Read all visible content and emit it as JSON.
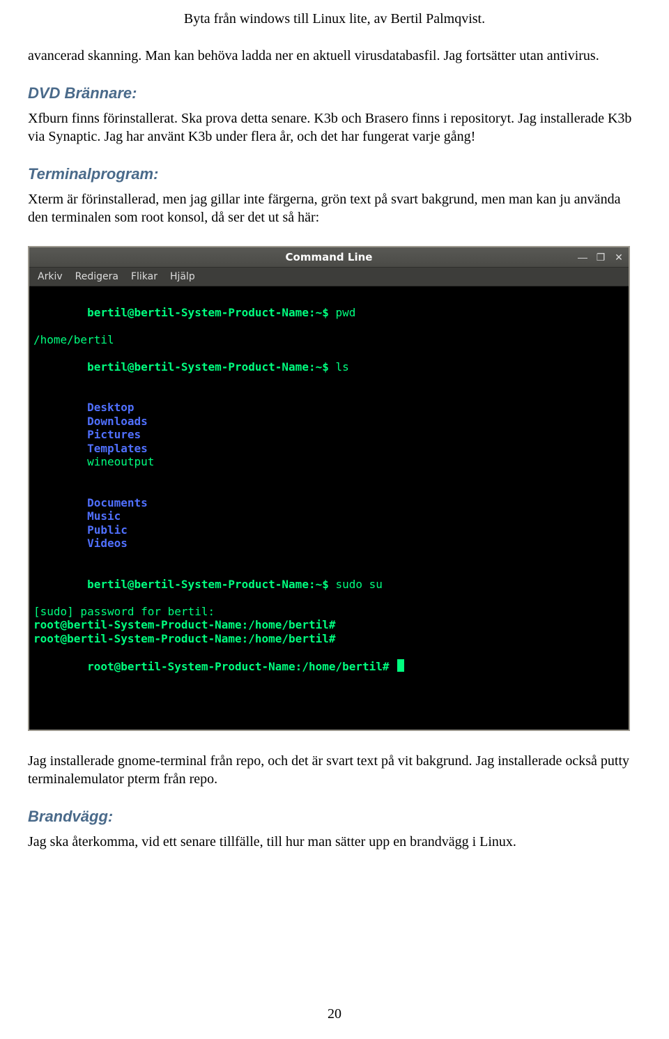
{
  "header": {
    "title": "Byta från windows till Linux lite, av Bertil Palmqvist."
  },
  "intro": {
    "p1": "avancerad skanning. Man kan behöva ladda ner en aktuell virusdatabasfil. Jag fortsätter utan antivirus."
  },
  "sections": {
    "dvd": {
      "heading": "DVD Brännare:",
      "p1": "Xfburn finns förinstallerat. Ska prova detta senare. K3b och Brasero finns i repositoryt. Jag installerade K3b via Synaptic. Jag har använt K3b under flera år, och det har fungerat varje gång!"
    },
    "terminal": {
      "heading": "Terminalprogram:",
      "p1": " Xterm är förinstallerad, men jag gillar inte färgerna, grön text på svart bakgrund, men man kan ju använda den terminalen som root konsol, då ser det ut så här:",
      "after1": "Jag installerade gnome-terminal från repo, och det är svart text på vit bakgrund. Jag installerade också putty terminalemulator pterm från repo."
    },
    "firewall": {
      "heading": "Brandvägg:",
      "p1": "Jag ska återkomma, vid ett senare tillfälle, till hur man sätter upp en brandvägg i Linux."
    }
  },
  "terminal_window": {
    "title": "Command Line",
    "buttons": {
      "min": "—",
      "max": "❐",
      "close": "✕"
    },
    "menu": [
      "Arkiv",
      "Redigera",
      "Flikar",
      "Hjälp"
    ],
    "lines": {
      "l1_prompt": "bertil@bertil-System-Product-Name:~$ ",
      "l1_cmd": "pwd",
      "l2": "/home/bertil",
      "l3_prompt": "bertil@bertil-System-Product-Name:~$ ",
      "l3_cmd": "ls",
      "ls_row1": {
        "c1": "Desktop",
        "c2": "Downloads",
        "c3": "Pictures",
        "c4": "Templates",
        "c5": "wineoutput"
      },
      "ls_row2": {
        "c1": "Documents",
        "c2": "Music",
        "c3": "Public",
        "c4": "Videos"
      },
      "l6_prompt": "bertil@bertil-System-Product-Name:~$ ",
      "l6_cmd": "sudo su",
      "l7": "[sudo] password for bertil:",
      "l8": "root@bertil-System-Product-Name:/home/bertil#",
      "l9": "root@bertil-System-Product-Name:/home/bertil#",
      "l10": "root@bertil-System-Product-Name:/home/bertil# "
    }
  },
  "page_number": "20"
}
